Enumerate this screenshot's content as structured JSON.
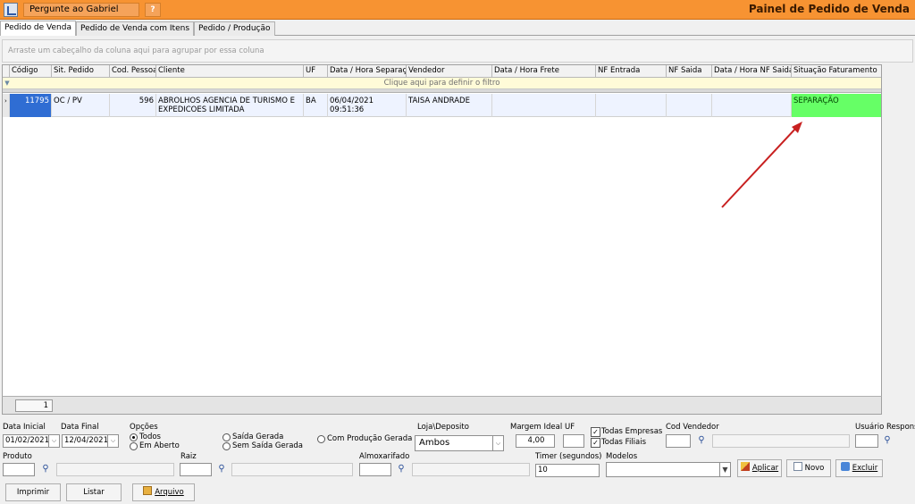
{
  "topbar": {
    "ask_label": "Pergunte ao Gabriel",
    "ask_button": "?",
    "title": "Painel de Pedido de Venda"
  },
  "tabs": [
    {
      "label": "Pedido de Venda"
    },
    {
      "label": "Pedido de Venda com Itens"
    },
    {
      "label": "Pedido / Produção"
    }
  ],
  "groupby_hint": "Arraste um cabeçalho da coluna aqui para agrupar por essa coluna",
  "grid": {
    "columns": [
      "Código",
      "Sit. Pedido",
      "Cod. Pessoa",
      "Cliente",
      "UF",
      "Data / Hora Separação",
      "Vendedor",
      "Data / Hora Frete",
      "NF Entrada",
      "NF Saida",
      "Data / Hora NF Saida",
      "Situação Faturamento"
    ],
    "filter_hint": "Clique aqui para definir o filtro",
    "rows": [
      {
        "codigo": "11795",
        "sit_pedido": "OC / PV",
        "cod_pessoa": "596",
        "cliente": "ABROLHOS AGENCIA DE TURISMO E EXPEDICOES LIMITADA",
        "uf": "BA",
        "data_separacao": "06/04/2021 09:51:36",
        "vendedor": "TAISA ANDRADE",
        "data_frete": "",
        "nf_entrada": "",
        "nf_saida": "",
        "data_nf_saida": "",
        "situacao_faturamento": "SEPARAÇÃO"
      }
    ],
    "status_color": "#66ff66"
  },
  "pager": {
    "page": "1"
  },
  "filters": {
    "data_inicial_label": "Data Inicial",
    "data_inicial": "01/02/2021",
    "data_final_label": "Data Final",
    "data_final": "12/04/2021",
    "opcoes_label": "Opções",
    "opt_todos": "Todos",
    "opt_em_aberto": "Em Aberto",
    "opt_saida_gerada": "Saída Gerada",
    "opt_sem_saida": "Sem Saída Gerada",
    "opt_producao": "Com Produção Gerada",
    "loja_label": "Loja\\Deposito",
    "loja_value": "Ambos",
    "margem_label": "Margem Ideal",
    "margem_value": "4,00",
    "uf_label": "UF",
    "uf_value": "",
    "todas_empresas": "Todas Empresas",
    "todas_filiais": "Todas Filiais",
    "cod_vendedor_label": "Cod Vendedor",
    "usuario_label": "Usuário Respons",
    "produto_label": "Produto",
    "raiz_label": "Raiz",
    "almoxarifado_label": "Almoxarifado",
    "timer_label": "Timer (segundos)",
    "timer_value": "10",
    "modelos_label": "Modelos"
  },
  "buttons": {
    "aplicar": "Aplicar",
    "novo": "Novo",
    "excluir": "Excluir",
    "imprimir": "Imprimir",
    "listar": "Listar",
    "arquivo": "Arquivo"
  }
}
